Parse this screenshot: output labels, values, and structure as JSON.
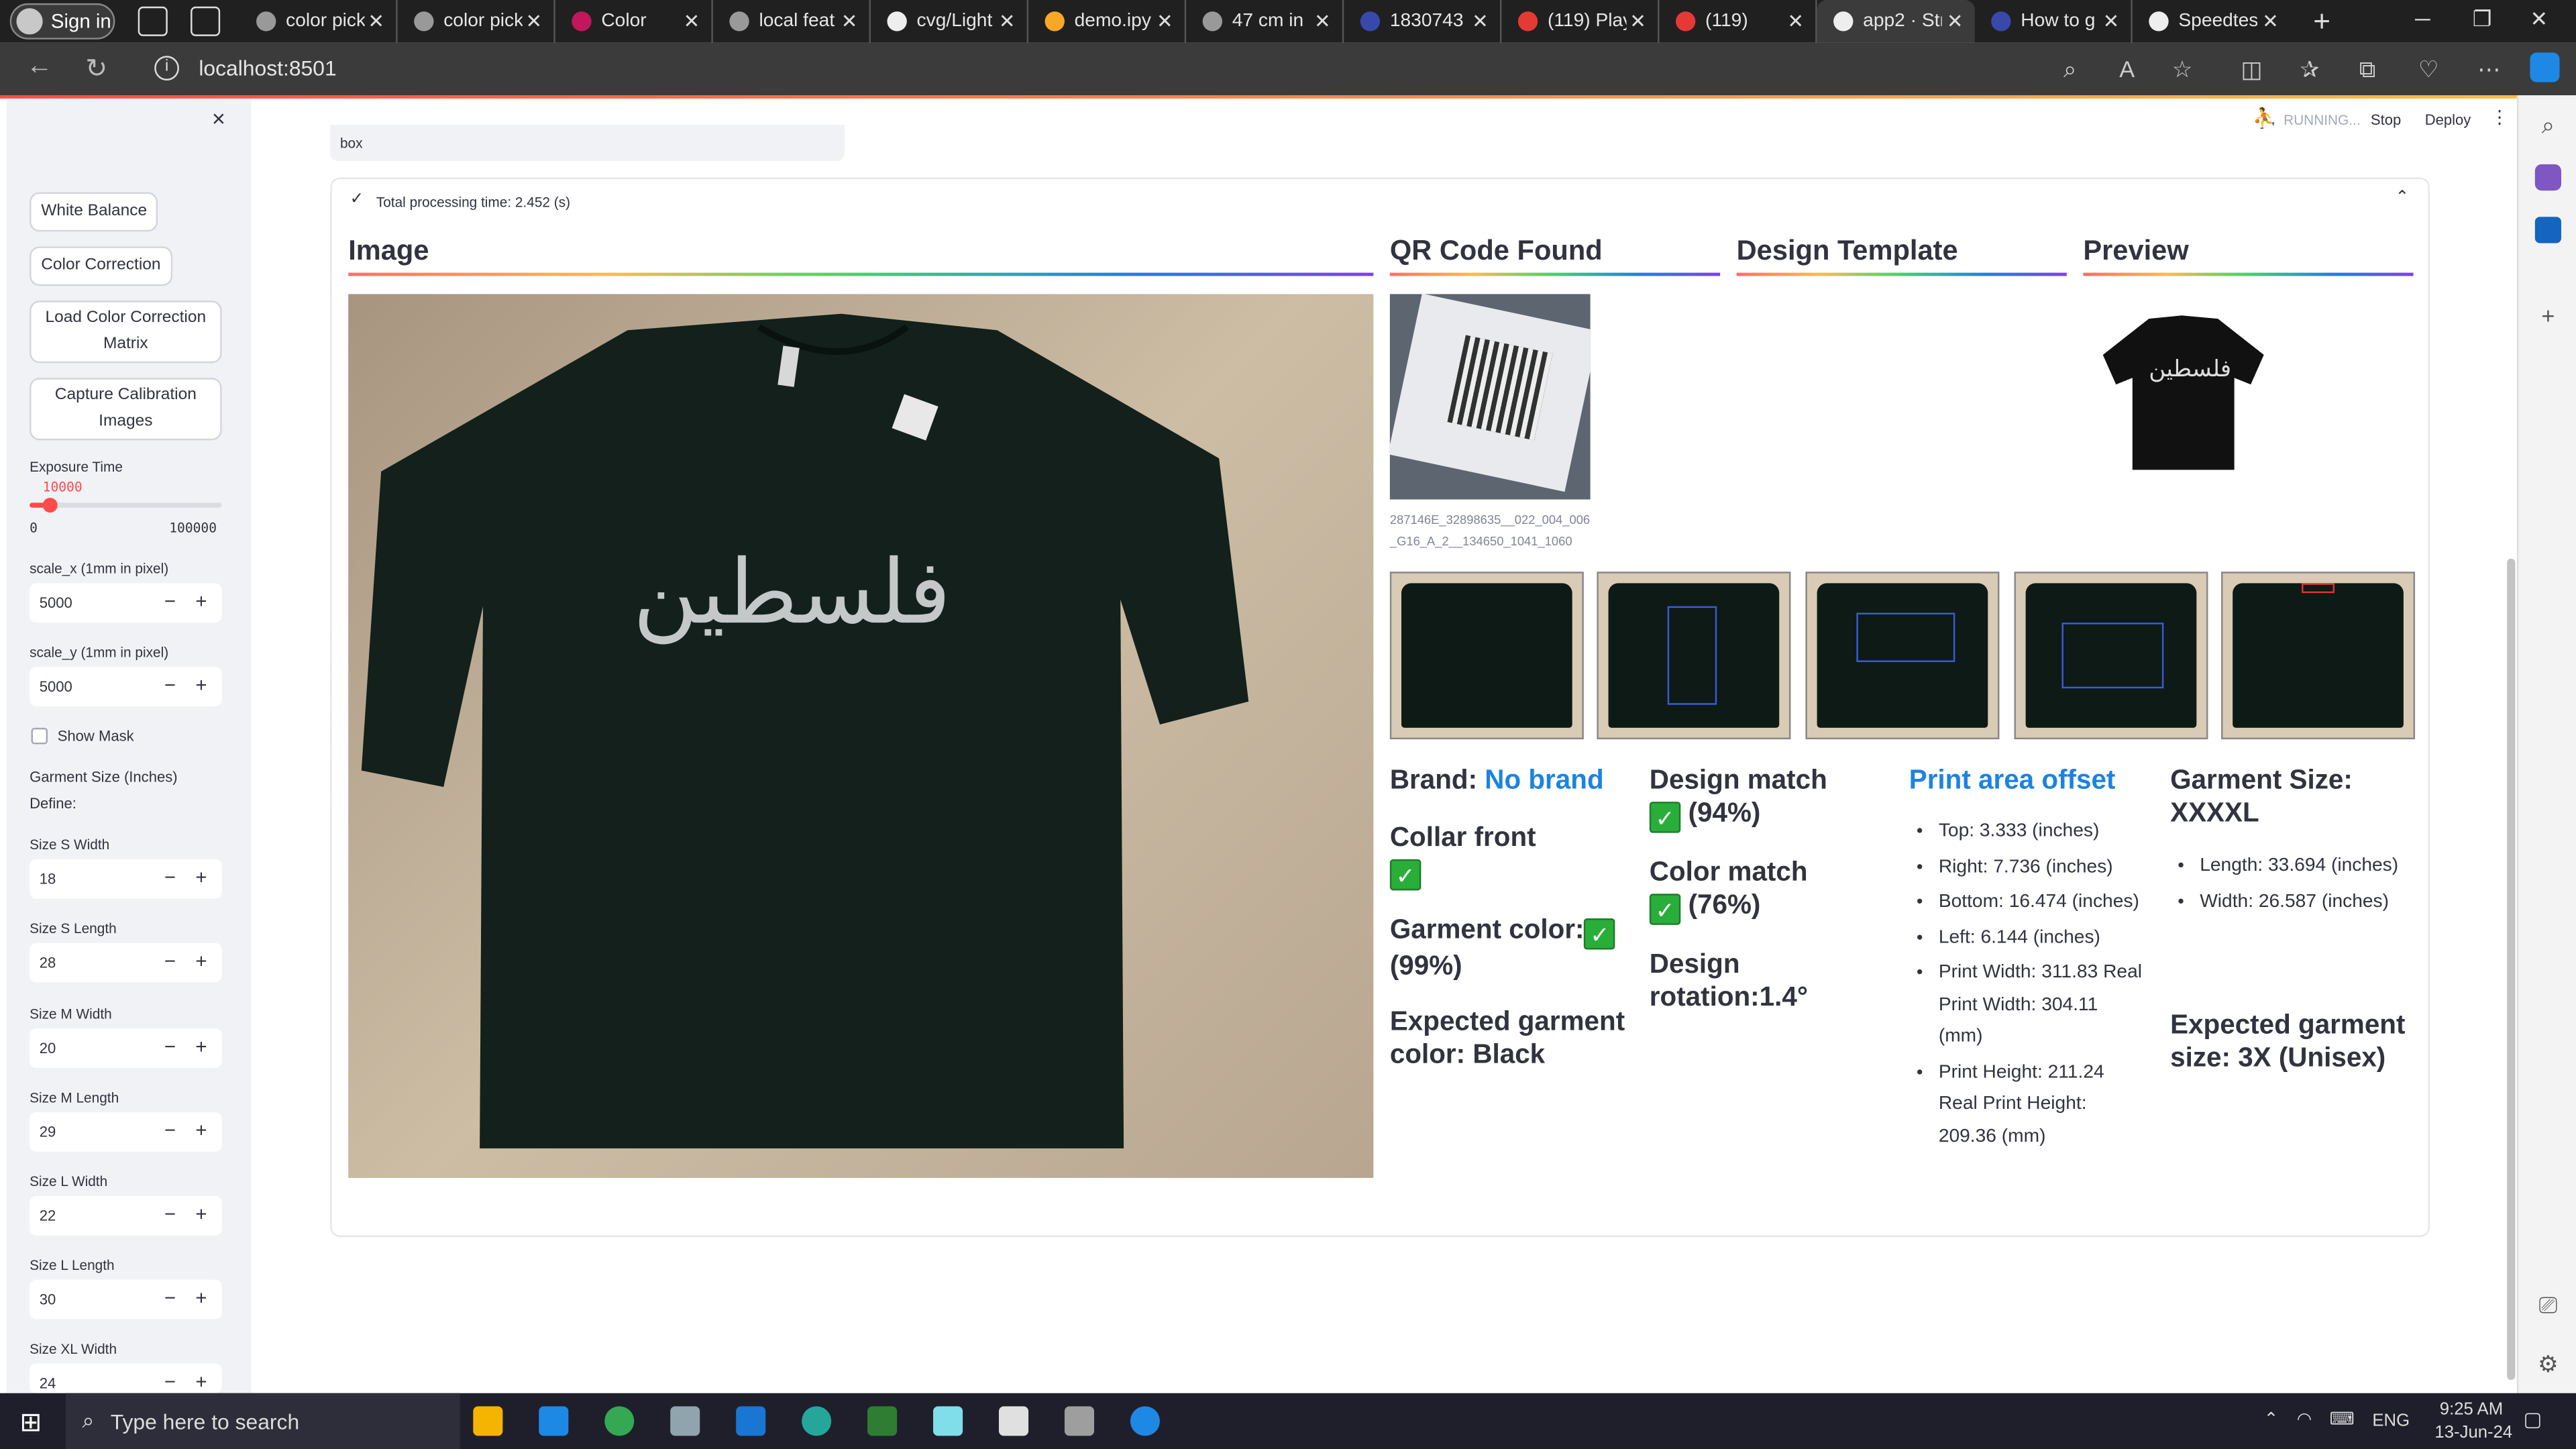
{
  "browser": {
    "signin": "Sign in",
    "tabs": [
      "color pick",
      "color pick",
      "Color",
      "local feat",
      "cvg/Light",
      "demo.ipy",
      "47 cm in",
      "1830743",
      "(119) Play",
      "(119)",
      "app2 · Str",
      "How to g",
      "Speedtest"
    ],
    "url": "localhost:8501"
  },
  "app": {
    "status": "RUNNING...",
    "stop": "Stop",
    "deploy": "Deploy",
    "box_label": "box",
    "processing": "Total processing time: 2.452 (s)"
  },
  "sidebar": {
    "close": "×",
    "white_balance": "White Balance",
    "color_correction": "Color Correction",
    "load_ccm": "Load Color Correction Matrix",
    "capture": "Capture Calibration Images",
    "exposure_label": "Exposure Time",
    "exposure_value": "10000",
    "exposure_fraction": 0.1,
    "exposure_min": "0",
    "exposure_max": "100000",
    "scale_x_label": "scale_x (1mm in pixel)",
    "scale_x": "5000",
    "scale_y_label": "scale_y (1mm in pixel)",
    "scale_y": "5000",
    "show_mask": "Show Mask",
    "garment_size": "Garment Size (Inches)",
    "define": "Define:",
    "sizes": [
      {
        "label": "Size S Width",
        "value": "18"
      },
      {
        "label": "Size S Length",
        "value": "28"
      },
      {
        "label": "Size M Width",
        "value": "20"
      },
      {
        "label": "Size M Length",
        "value": "29"
      },
      {
        "label": "Size L Width",
        "value": "22"
      },
      {
        "label": "Size L Length",
        "value": "30"
      },
      {
        "label": "Size XL Width",
        "value": "24"
      }
    ]
  },
  "main": {
    "image_header": "Image",
    "qr_header": "QR Code Found",
    "design_header": "Design Template",
    "preview_header": "Preview",
    "qr_caption": "287146E_32898635__022_004_006_G16_A_2__134650_1041_1060",
    "tshirt_text": "فلسطين",
    "brand_label": "Brand: ",
    "brand_value": "No brand",
    "collar": "Collar front",
    "garment_color": "Garment color:",
    "garment_color_pct": "(99%)",
    "expected_color": "Expected garment color: Black",
    "design_match": "Design match",
    "design_match_pct": "(94%)",
    "color_match": "Color match",
    "color_match_pct": "(76%)",
    "rotation": "Design rotation:1.4°",
    "offset_title": "Print area offset",
    "offsets": [
      "Top: 3.333 (inches)",
      "Right: 7.736 (inches)",
      "Bottom: 16.474 (inches)",
      "Left: 6.144 (inches)",
      "Print Width: 311.83 Real Print Width: 304.11 (mm)",
      "Print Height: 211.24 Real Print Height: 209.36 (mm)"
    ],
    "garment_size_title": "Garment Size: XXXXL",
    "garment_dims": [
      "Length: 33.694 (inches)",
      "Width: 26.587 (inches)"
    ],
    "expected_size": "Expected garment size: 3X (Unisex)"
  },
  "taskbar": {
    "search": "Type here to search",
    "time": "9:25 AM",
    "date": "13-Jun-24",
    "lang": "ENG"
  }
}
